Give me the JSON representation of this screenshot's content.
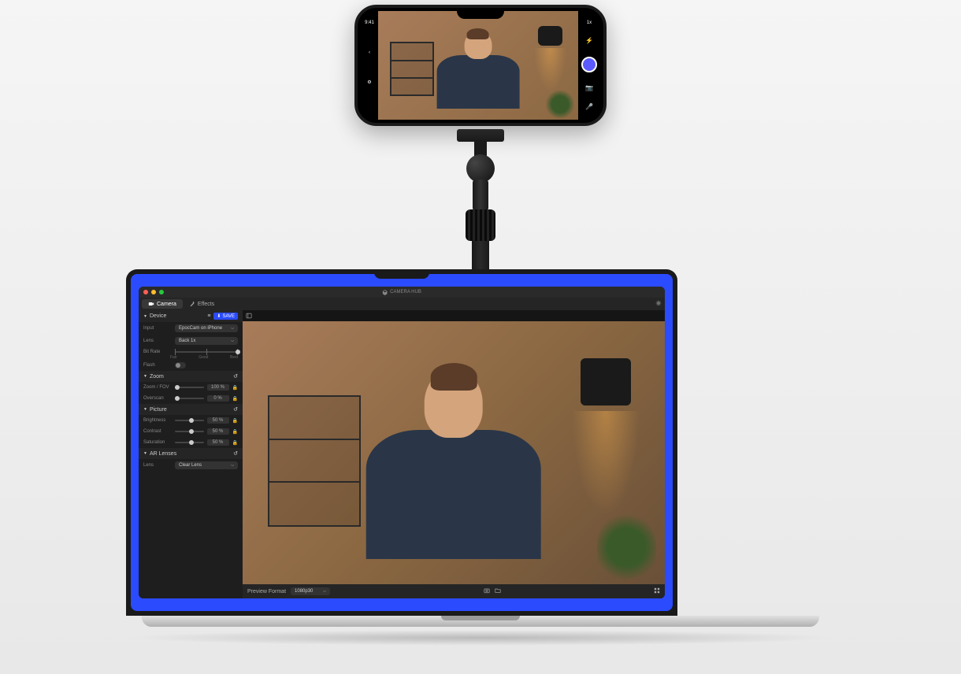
{
  "app_title": "CAMERA HUB",
  "tabs": {
    "camera": "Camera",
    "effects": "Effects"
  },
  "sections": {
    "device": {
      "title": "Device",
      "save": "SAVE",
      "input_label": "Input",
      "input_value": "EpocCam on iPhone",
      "lens_label": "Lens",
      "lens_value": "Back 1x",
      "bitrate_label": "Bit Rate",
      "bitrate_marks": {
        "fair": "Fair",
        "good": "Good",
        "best": "Best"
      },
      "flash_label": "Flash"
    },
    "zoom": {
      "title": "Zoom",
      "zoom_label": "Zoom / FOV",
      "zoom_value": "100 %",
      "overscan_label": "Overscan",
      "overscan_value": "0 %"
    },
    "picture": {
      "title": "Picture",
      "brightness_label": "Brightness",
      "brightness_value": "50 %",
      "contrast_label": "Contrast",
      "contrast_value": "50 %",
      "saturation_label": "Saturation",
      "saturation_value": "50 %"
    },
    "ar": {
      "title": "AR Lenses",
      "lens_label": "Lens",
      "lens_value": "Clear Lens"
    }
  },
  "bottom": {
    "format_label": "Preview Format",
    "format_value": "1080p30"
  },
  "phone": {
    "time": "9:41",
    "zoom": "1x"
  }
}
